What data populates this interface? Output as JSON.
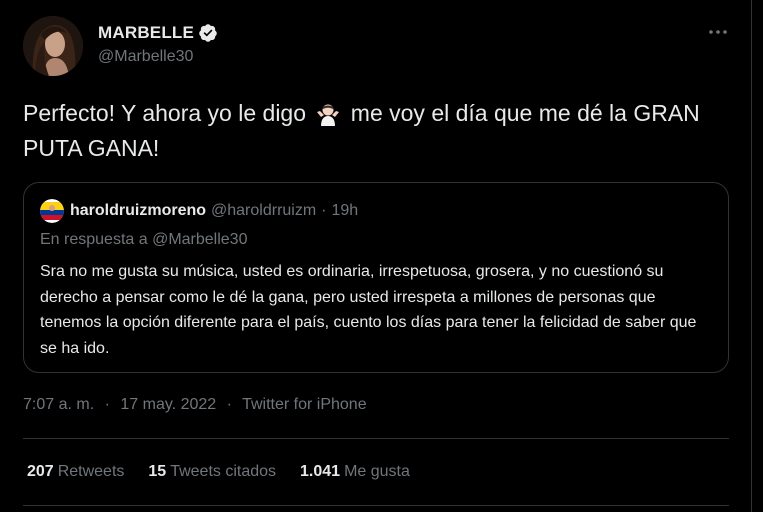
{
  "tweet": {
    "author": {
      "display_name": "MARBELLE",
      "handle": "@Marbelle30",
      "verified": true,
      "avatar_icon": "profile-photo"
    },
    "more_icon": "more-horizontal-icon",
    "text_part1": "Perfecto! Y ahora yo le digo",
    "emoji": "woman-shrugging-emoji",
    "text_part2": "me voy el día que me dé la GRAN PUTA GANA!",
    "quoted": {
      "display_name": "haroldruizmoreno",
      "handle": "@haroldrruizm",
      "separator": "·",
      "time": "19h",
      "reply_prefix": "En respuesta a",
      "reply_to": "@Marbelle30",
      "text": "Sra no me gusta su música, usted es ordinaria, irrespetuosa, grosera, y no cuestionó su derecho a pensar como le dé la gana, pero usted irrespeta a millones de personas que tenemos la opción diferente para el país, cuento los días para tener la felicidad de saber que se ha ido.",
      "avatar_icon": "colombia-flag-avatar"
    },
    "meta": {
      "time": "7:07 a. m.",
      "separator": "·",
      "date": "17 may. 2022",
      "source": "Twitter for iPhone"
    },
    "stats": {
      "retweets_count": "207",
      "retweets_label": "Retweets",
      "quotes_count": "15",
      "quotes_label": "Tweets citados",
      "likes_count": "1.041",
      "likes_label": "Me gusta"
    }
  },
  "colors": {
    "background": "#000000",
    "text_primary": "#e7e9ea",
    "text_secondary": "#71767b",
    "border": "#2f3336",
    "verified_badge": "#e7e9ea"
  }
}
